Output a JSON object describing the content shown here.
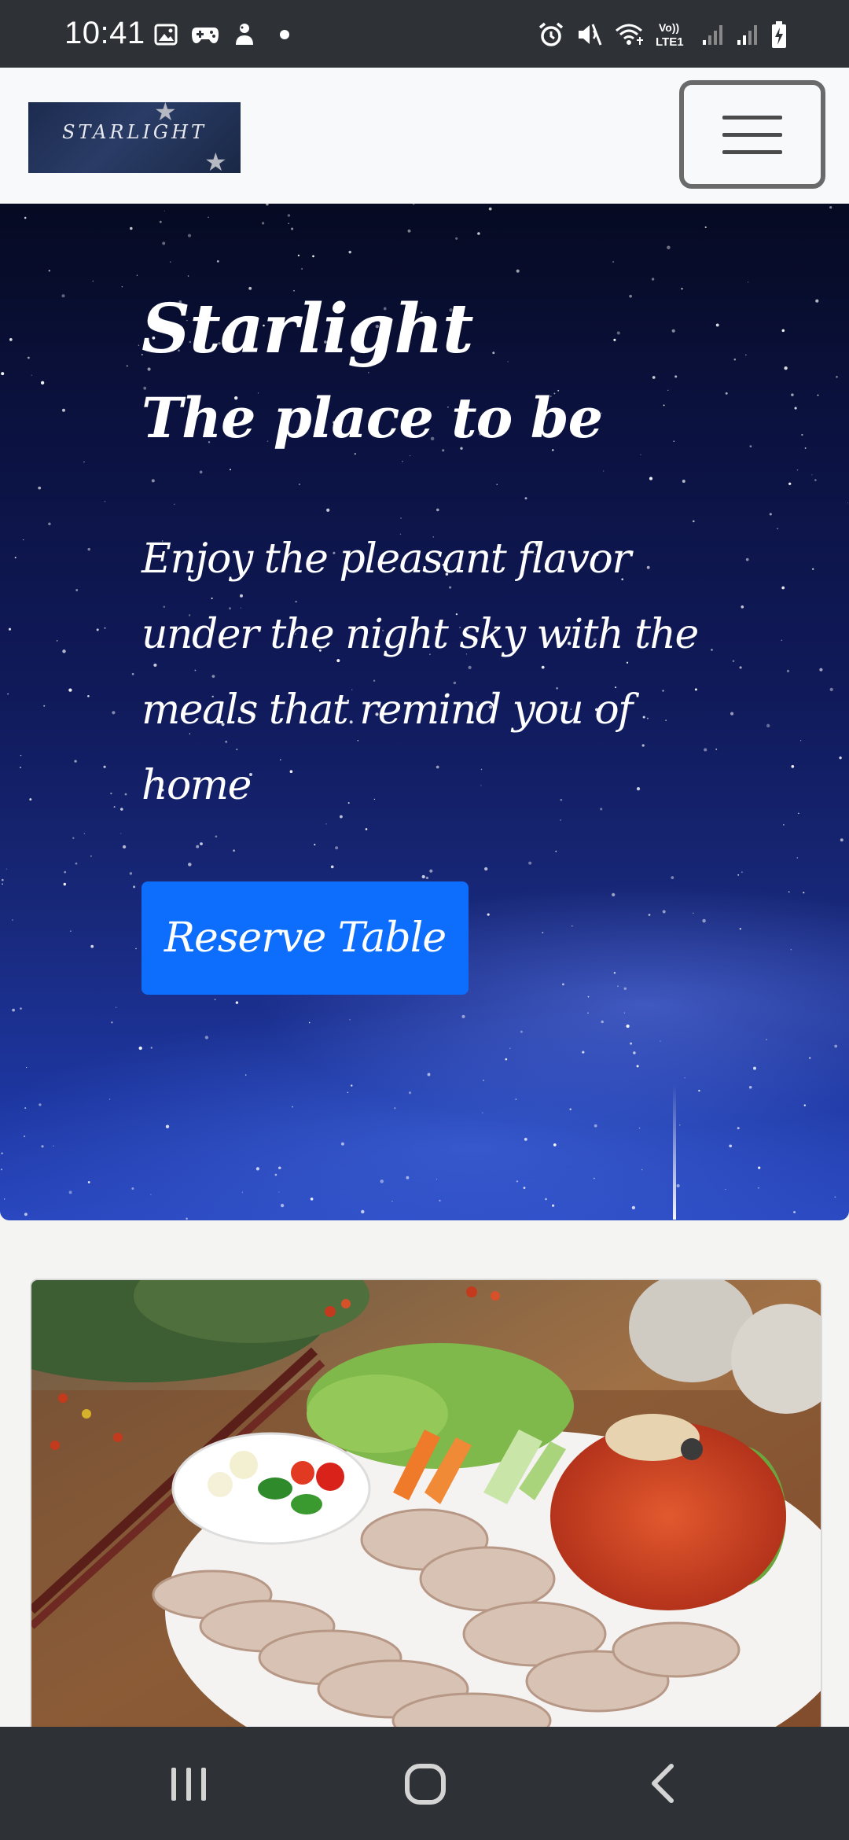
{
  "status_bar": {
    "time": "10:41",
    "left_icons": [
      "gallery-icon",
      "game-icon",
      "notification-app-icon",
      "dot-icon"
    ],
    "right_icons": [
      "alarm-icon",
      "mute-icon",
      "wifi-calling-icon",
      "volte-lte-icon",
      "signal-icon",
      "signal-icon-2",
      "battery-charging-icon"
    ],
    "volte_label": "Vo))",
    "lte_label": "LTE1"
  },
  "navbar": {
    "logo_text": "STARLIGHT",
    "menu_icon": "hamburger-menu-icon"
  },
  "hero": {
    "title": "Starlight",
    "subtitle": "The place to be",
    "text": "Enjoy the pleasant flavor under the night sky with the meals that remind you of home",
    "button_label": "Reserve Table",
    "button_color": "#0d6efd"
  },
  "food_card": {
    "image_description_icon": "food-photo"
  },
  "bottom_nav": {
    "icons": [
      "recent-apps-icon",
      "home-icon",
      "back-icon"
    ]
  }
}
